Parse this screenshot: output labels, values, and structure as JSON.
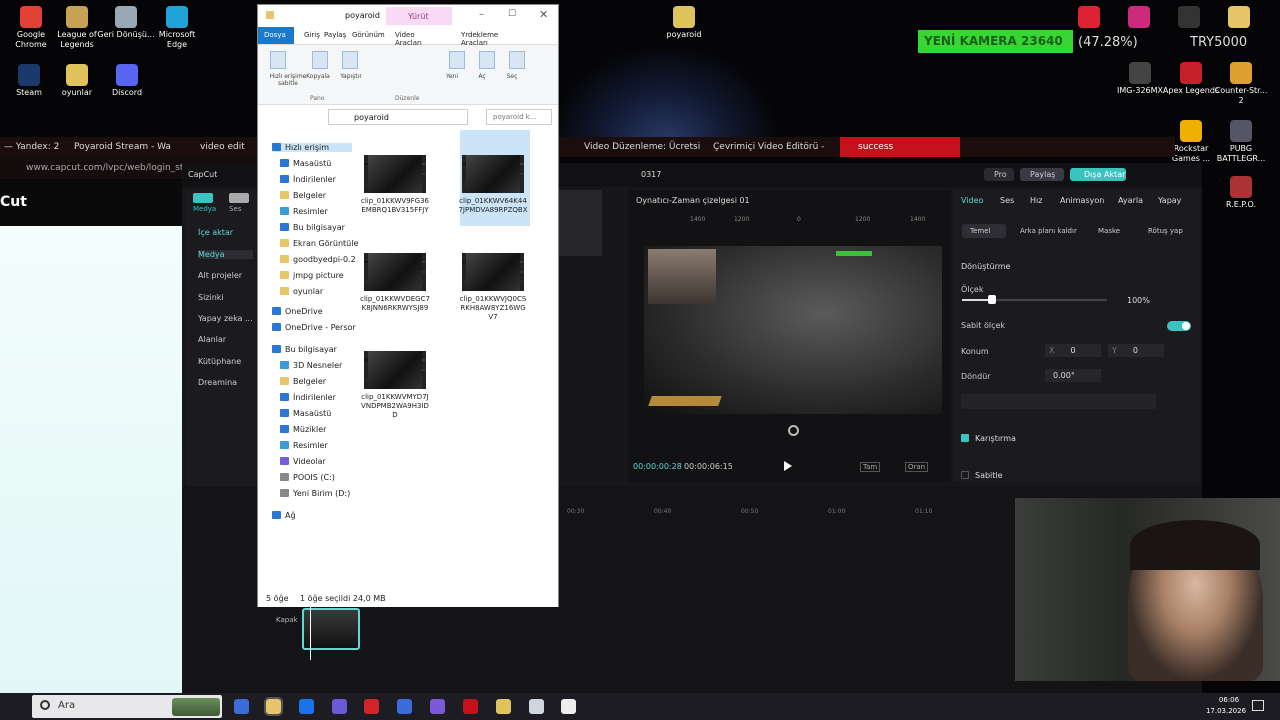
{
  "desktop": {
    "left_icons": [
      {
        "label": "Google Chrome",
        "color": "#e34133"
      },
      {
        "label": "League of Legends",
        "color": "#c8a253"
      },
      {
        "label": "Geri Dönüşü...",
        "color": "#9aa7b5"
      },
      {
        "label": "Microsoft Edge",
        "color": "#1fa3d8"
      },
      {
        "label": "Steam",
        "color": "#1b3a6b"
      },
      {
        "label": "oyunlar",
        "color": "#e0c35a"
      },
      {
        "label": "Discord",
        "color": "#5865f2"
      }
    ],
    "right_icons": [
      {
        "label": "poyaroid",
        "color": "#e0c35a"
      },
      {
        "label": "IMG-326MX",
        "color": "#444"
      },
      {
        "label": "Apex Legends",
        "color": "#c8202a"
      },
      {
        "label": "Counter-Str... 2",
        "color": "#e0a030"
      },
      {
        "label": "Rockstar Games ...",
        "color": "#f0b000"
      },
      {
        "label": "PUBG BATTLEGR...",
        "color": "#556"
      },
      {
        "label": "R.E.P.O.",
        "color": "#a33"
      }
    ]
  },
  "overlay": {
    "camera_label": "YENİ KAMERA",
    "camera_count": "23640",
    "camera_percent": "(47.28%)",
    "currency": "TRY5000"
  },
  "browser": {
    "tabs": [
      "— Yandex: 2",
      "Poyaroid Stream - Wa",
      "video edit",
      "Video Düzenleme: Ücretsi",
      "Çevrimiçi Video Editörü -",
      "success"
    ],
    "url": "www.capcut.com/lvpc/web/login_stat",
    "page_left_label": "Cut"
  },
  "explorer": {
    "title": "poyaroid",
    "contextual_tab": "Yürüt",
    "ribbon_tabs": [
      "Dosya",
      "Giriş",
      "Paylaş",
      "Görünüm",
      "Video Araçları",
      "Yrdekleme Araçları"
    ],
    "ribbon_buttons": [
      "Hızlı erişime sabitle",
      "Kopyala",
      "Yapıştır",
      "Yeni",
      "Aç",
      "Seç"
    ],
    "ribbon_groups": [
      "Pano",
      "Düzenle"
    ],
    "address": "poyaroid",
    "search_placeholder": "poyaroid k...",
    "nav": [
      {
        "label": "Hızlı erişim",
        "color": "#2b78d4"
      },
      {
        "label": "Masaüstü",
        "color": "#2b78d4"
      },
      {
        "label": "İndirilenler",
        "color": "#2b78d4"
      },
      {
        "label": "Belgeler",
        "color": "#e6c56b"
      },
      {
        "label": "Resimler",
        "color": "#3b9bd6"
      },
      {
        "label": "Bu bilgisayar",
        "color": "#2b78d4"
      },
      {
        "label": "Ekran Görüntüle",
        "color": "#e6c56b"
      },
      {
        "label": "goodbyedpi-0.2",
        "color": "#e6c56b"
      },
      {
        "label": "jmpg picture",
        "color": "#e6c56b"
      },
      {
        "label": "oyunlar",
        "color": "#e6c56b"
      },
      {
        "label": "OneDrive",
        "color": "#2b78d4"
      },
      {
        "label": "OneDrive - Persor",
        "color": "#2b78d4"
      },
      {
        "label": "Bu bilgisayar",
        "color": "#2b78d4"
      },
      {
        "label": "3D Nesneler",
        "color": "#3b9bd6"
      },
      {
        "label": "Belgeler",
        "color": "#e6c56b"
      },
      {
        "label": "İndirilenler",
        "color": "#2b78d4"
      },
      {
        "label": "Masaüstü",
        "color": "#2b78d4"
      },
      {
        "label": "Müzikler",
        "color": "#2b78d4"
      },
      {
        "label": "Resimler",
        "color": "#3b9bd6"
      },
      {
        "label": "Videolar",
        "color": "#7a5ad6"
      },
      {
        "label": "POOIS (C:)",
        "color": "#888"
      },
      {
        "label": "Yeni Birim (D:)",
        "color": "#888"
      },
      {
        "label": "Ağ",
        "color": "#2b78d4"
      }
    ],
    "files": [
      "clip_01KKWV9FG36EMBRQ1BV315FFJY",
      "clip_01KKWV64K447JPMDVA89RPZQBX",
      "clip_01KKWVDEGC7K8JNN6RKRWYSJ89",
      "clip_01KKWVJQ0CSRKH8AW8YZ16WGV7",
      "clip_01KKWVMYD7JVNDPMB2WA9H3IDD"
    ],
    "status_count": "5 öğe",
    "status_selected": "1 öğe seçildi  24,0 MB"
  },
  "capcut": {
    "brand": "CapCut",
    "project": "0317",
    "top_buttons": [
      "Pro",
      "Paylaş",
      "Dışa Aktar"
    ],
    "side_tabs": [
      "Medya",
      "Ses",
      "Men"
    ],
    "side_items": [
      "İçe aktar",
      "Medya",
      "Alt projeler",
      "Sizinki",
      "Yapay zeka ...",
      "Alanlar",
      "Kütüphane",
      "Dreamina"
    ],
    "player_title": "Oynatıcı-Zaman çizelgesi 01",
    "ruler": [
      "1400",
      "1200",
      "0",
      "1200",
      "1400"
    ],
    "time_current": "00:00:00:28",
    "time_total": "00:00:06:15",
    "player_controls": [
      "Tam",
      "Oran"
    ],
    "prop_tabs": [
      "Video",
      "Ses",
      "Hız",
      "Animasyon",
      "Ayarla",
      "Yapay"
    ],
    "prop_subtabs": [
      "Temel",
      "Arka planı kaldır",
      "Maske",
      "Rötuş yap"
    ],
    "transform_label": "Dönüştürme",
    "scale_label": "Ölçek",
    "scale_value": "100%",
    "uniform_scale_label": "Sabit ölçek",
    "position_label": "Konum",
    "pos_x_label": "X",
    "pos_x": "0",
    "pos_y_label": "Y",
    "pos_y": "0",
    "rotate_label": "Döndür",
    "rotate_value": "0.00°",
    "blend_label": "Karıştırma",
    "stabilize_label": "Sabitle",
    "timeline_marks": [
      "00:30",
      "00:40",
      "00:50",
      "01:00",
      "01:10"
    ],
    "cover_label": "Kapak",
    "accent": "#5fd9d2"
  },
  "taskbar": {
    "search_placeholder": "Ara",
    "time": "06:06",
    "date": "17.03.2026"
  }
}
